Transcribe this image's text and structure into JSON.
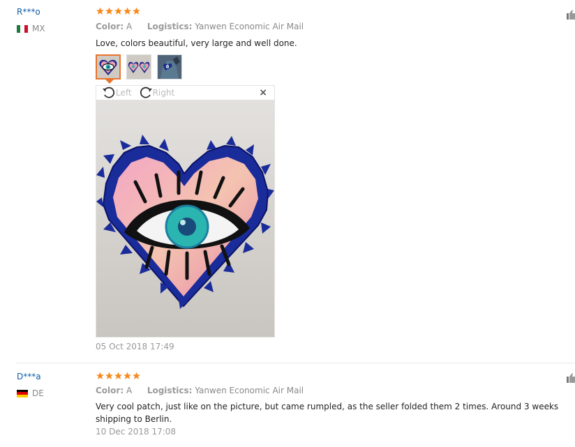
{
  "reviews": [
    {
      "user": "R***o",
      "country": "MX",
      "rating": 5,
      "color_key": "Color:",
      "color_val": "A",
      "logistics_key": "Logistics:",
      "logistics_val": "Yanwen Economic Air Mail",
      "text": "Love, colors beautiful, very large and well done.",
      "date": "05 Oct 2018 17:49",
      "viewer": {
        "left_label": "Left",
        "right_label": "Right",
        "close": "×"
      }
    },
    {
      "user": "D***a",
      "country": "DE",
      "rating": 5,
      "color_key": "Color:",
      "color_val": "A",
      "logistics_key": "Logistics:",
      "logistics_val": "Yanwen Economic Air Mail",
      "text": "Very cool patch, just like on the picture, but came rumpled, as the seller folded them 2 times. Around 3 weeks shipping to Berlin.",
      "date": "10 Dec 2018 17:08"
    }
  ],
  "colors": {
    "star": "#f68a1e",
    "username": "#0d5ca8",
    "selected_thumb": "#e8742c"
  }
}
